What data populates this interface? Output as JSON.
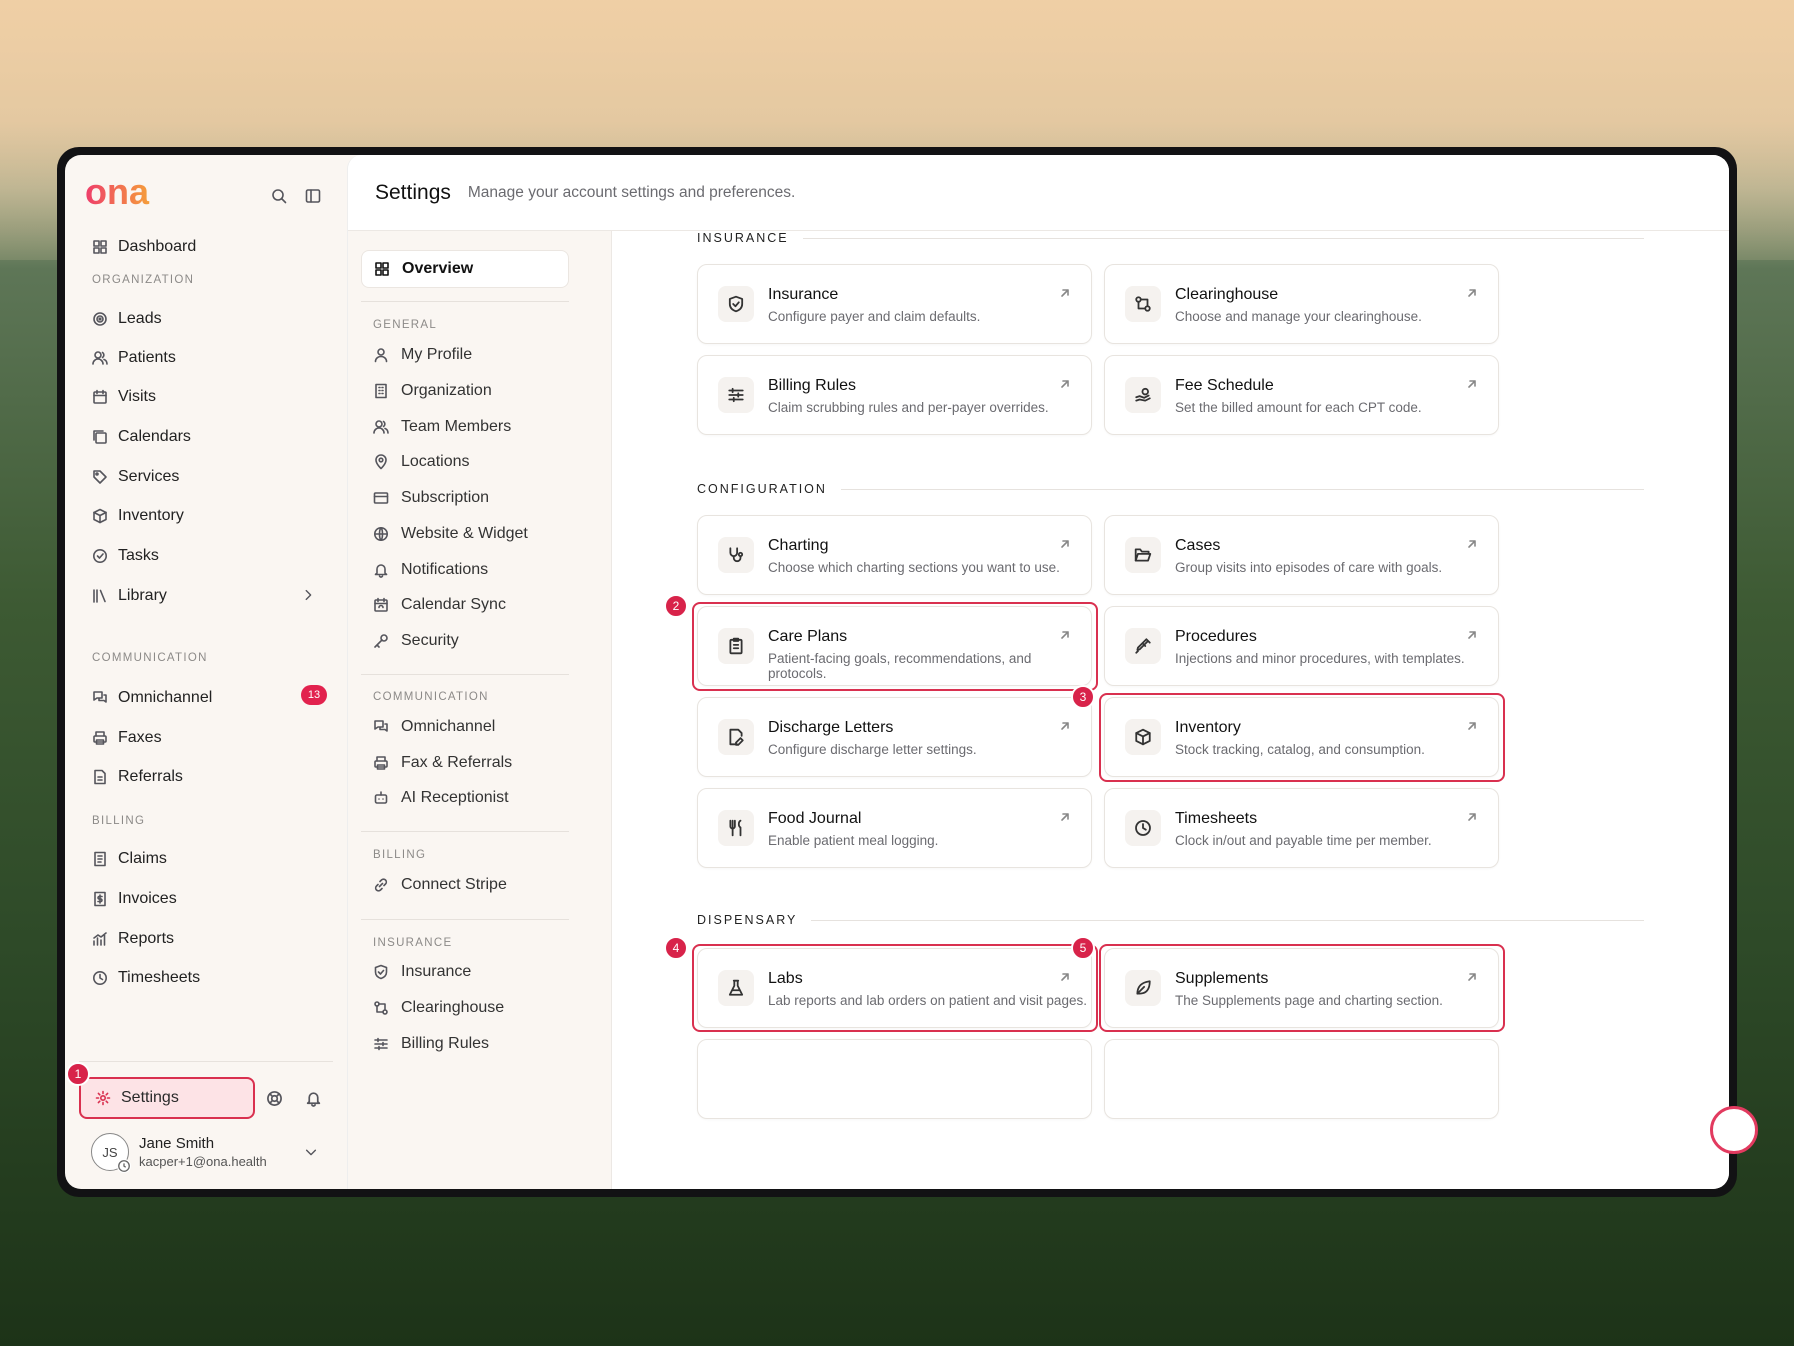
{
  "brand": {
    "logo": "ona",
    "accent": "#e2224e",
    "logo_gradient": [
      "#ee3d6b",
      "#f59f3a"
    ]
  },
  "sidebar": {
    "dashboard": "Dashboard",
    "sections": {
      "organization": "ORGANIZATION",
      "communication": "COMMUNICATION",
      "billing": "BILLING"
    },
    "organization": [
      {
        "label": "Leads",
        "icon": "target-icon"
      },
      {
        "label": "Patients",
        "icon": "users-icon"
      },
      {
        "label": "Visits",
        "icon": "calendar-icon"
      },
      {
        "label": "Calendars",
        "icon": "calendars-icon"
      },
      {
        "label": "Services",
        "icon": "tag-icon"
      },
      {
        "label": "Inventory",
        "icon": "box-icon"
      },
      {
        "label": "Tasks",
        "icon": "check-circle-icon"
      },
      {
        "label": "Library",
        "icon": "library-icon"
      }
    ],
    "communication": [
      {
        "label": "Omnichannel",
        "icon": "chat-icon",
        "badge": "13"
      },
      {
        "label": "Faxes",
        "icon": "printer-icon"
      },
      {
        "label": "Referrals",
        "icon": "document-icon"
      }
    ],
    "billing": [
      {
        "label": "Claims",
        "icon": "receipt-icon"
      },
      {
        "label": "Invoices",
        "icon": "invoice-icon"
      },
      {
        "label": "Reports",
        "icon": "chart-icon"
      },
      {
        "label": "Timesheets",
        "icon": "clock-icon"
      }
    ],
    "settings": "Settings",
    "user": {
      "initials": "JS",
      "name": "Jane Smith",
      "email": "kacper+1@ona.health"
    }
  },
  "header": {
    "title": "Settings",
    "subtitle": "Manage your account settings and preferences."
  },
  "subnav": {
    "overview": "Overview",
    "sections": {
      "general": "GENERAL",
      "communication": "COMMUNICATION",
      "billing": "BILLING",
      "insurance": "INSURANCE"
    },
    "general": [
      "My Profile",
      "Organization",
      "Team Members",
      "Locations",
      "Subscription",
      "Website & Widget",
      "Notifications",
      "Calendar Sync",
      "Security"
    ],
    "communication": [
      "Omnichannel",
      "Fax & Referrals",
      "AI Receptionist"
    ],
    "billing": [
      "Connect Stripe"
    ],
    "insurance": [
      "Insurance",
      "Clearinghouse",
      "Billing Rules"
    ]
  },
  "content": {
    "sections": {
      "insurance": "INSURANCE",
      "configuration": "CONFIGURATION",
      "dispensary": "DISPENSARY"
    },
    "insurance": [
      {
        "title": "Insurance",
        "desc": "Configure payer and claim defaults."
      },
      {
        "title": "Clearinghouse",
        "desc": "Choose and manage your clearinghouse."
      },
      {
        "title": "Billing Rules",
        "desc": "Claim scrubbing rules and per-payer overrides."
      },
      {
        "title": "Fee Schedule",
        "desc": "Set the billed amount for each CPT code."
      }
    ],
    "configuration": [
      {
        "title": "Charting",
        "desc": "Choose which charting sections you want to use."
      },
      {
        "title": "Cases",
        "desc": "Group visits into episodes of care with goals."
      },
      {
        "title": "Care Plans",
        "desc": "Patient-facing goals, recommendations, and protocols."
      },
      {
        "title": "Procedures",
        "desc": "Injections and minor procedures, with templates."
      },
      {
        "title": "Discharge Letters",
        "desc": "Configure discharge letter settings."
      },
      {
        "title": "Inventory",
        "desc": "Stock tracking, catalog, and consumption."
      },
      {
        "title": "Food Journal",
        "desc": "Enable patient meal logging."
      },
      {
        "title": "Timesheets",
        "desc": "Clock in/out and payable time per member."
      }
    ],
    "dispensary": [
      {
        "title": "Labs",
        "desc": "Lab reports and lab orders on patient and visit pages."
      },
      {
        "title": "Supplements",
        "desc": "The Supplements page and charting section."
      }
    ]
  },
  "markers": [
    "1",
    "2",
    "3",
    "4",
    "5"
  ]
}
